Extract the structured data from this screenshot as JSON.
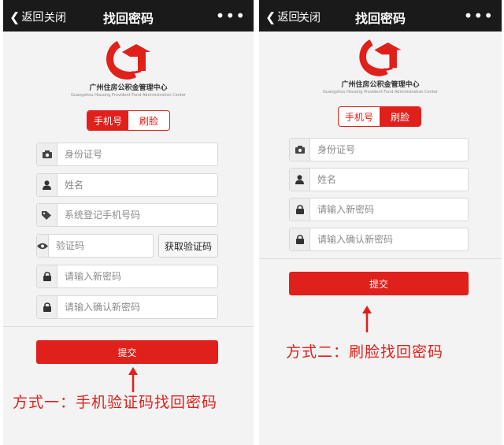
{
  "colors": {
    "accent": "#e0201b",
    "topbar": "#1a1a1a",
    "background": "#f3f3f3"
  },
  "left": {
    "topbar": {
      "back_label": "返回",
      "close_label": "关闭",
      "title": "找回密码",
      "more_label": "•••"
    },
    "logo": {
      "org_name": "广州住房公积金管理中心",
      "org_name_en": "Guangzhou Housing Provident Fund Administration Center"
    },
    "toggle": {
      "options": [
        "手机号",
        "刷脸"
      ],
      "active_index": 0
    },
    "fields": [
      {
        "icon": "camera-icon",
        "placeholder": "身份证号"
      },
      {
        "icon": "user-icon",
        "placeholder": "姓名"
      },
      {
        "icon": "tag-icon",
        "placeholder": "系统登记手机号码"
      },
      {
        "icon": "eye-icon",
        "placeholder": "验证码"
      },
      {
        "icon": "lock-icon",
        "placeholder": "请输入新密码"
      },
      {
        "icon": "lock-icon",
        "placeholder": "请输入确认新密码"
      }
    ],
    "get_code_label": "获取验证码",
    "submit_label": "提交",
    "caption": "方式一：手机验证码找回密码"
  },
  "right": {
    "topbar": {
      "back_label": "返回",
      "close_label": "关闭",
      "title": "找回密码",
      "more_label": "•••"
    },
    "logo": {
      "org_name": "广州住房公积金管理中心",
      "org_name_en": "Guangzhou Housing Provident Fund Administration Center"
    },
    "toggle": {
      "options": [
        "手机号",
        "刷脸"
      ],
      "active_index": 1
    },
    "fields": [
      {
        "icon": "camera-icon",
        "placeholder": "身份证号"
      },
      {
        "icon": "user-icon",
        "placeholder": "姓名"
      },
      {
        "icon": "lock-icon",
        "placeholder": "请输入新密码"
      },
      {
        "icon": "lock-icon",
        "placeholder": "请输入确认新密码"
      }
    ],
    "submit_label": "提交",
    "caption": "方式二：刷脸找回密码"
  }
}
